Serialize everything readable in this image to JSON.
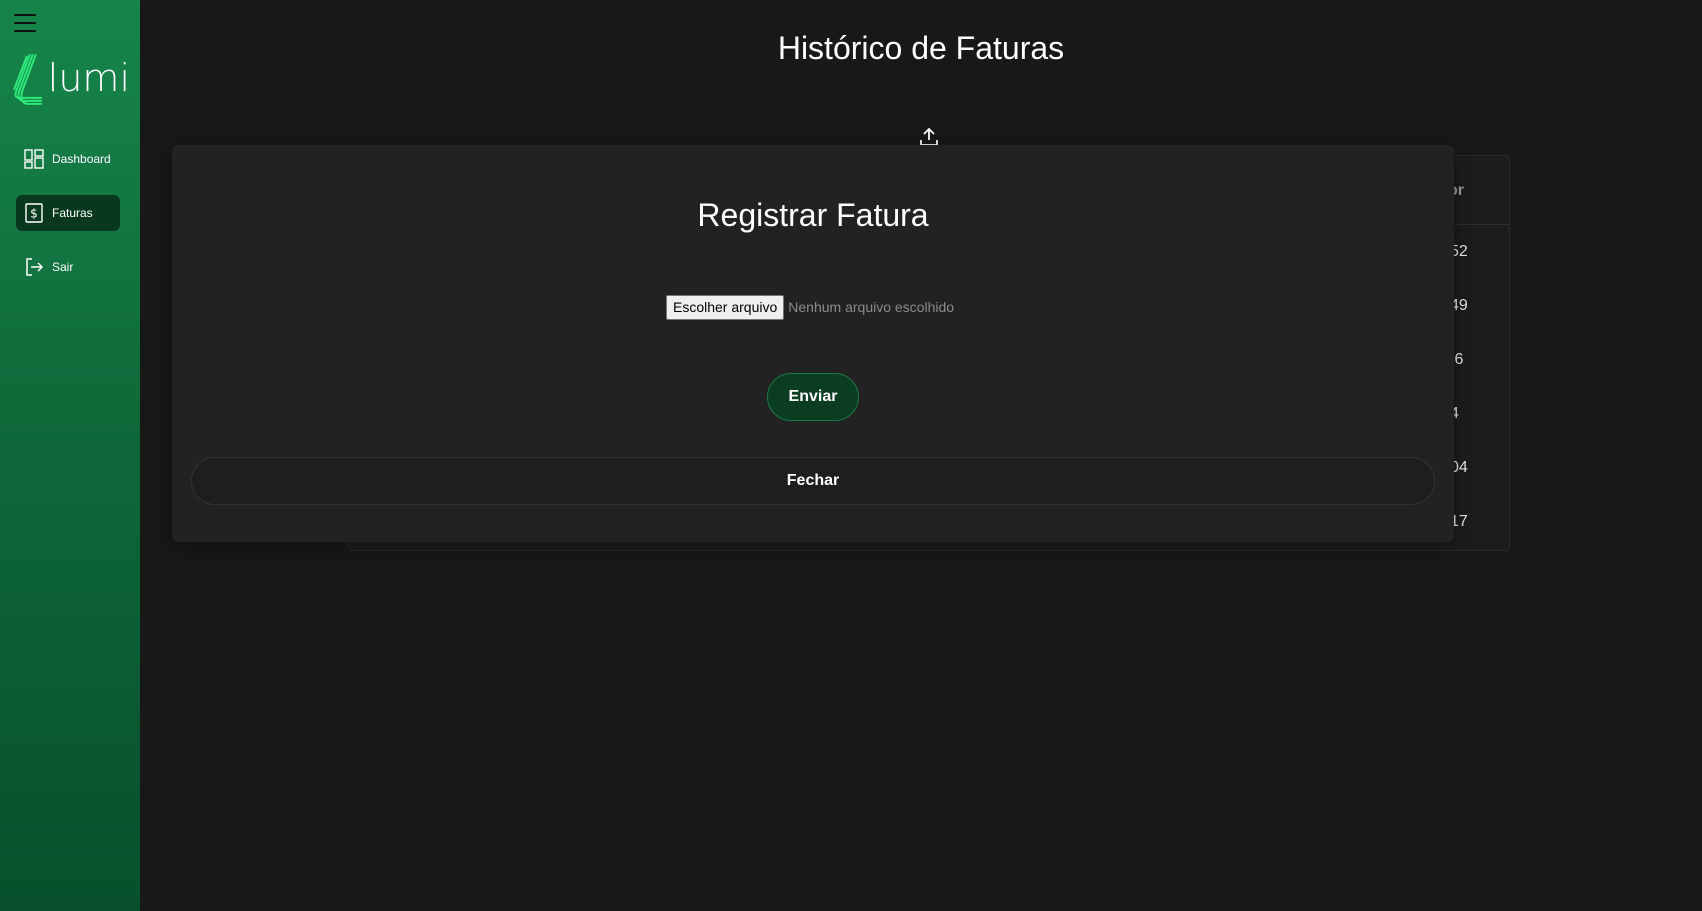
{
  "sidebar": {
    "logo_text": "lumi",
    "items": [
      {
        "label": "Dashboard",
        "icon": "dashboard-grid-icon"
      },
      {
        "label": "Faturas",
        "icon": "dollar-document-icon"
      },
      {
        "label": "Sair",
        "icon": "logout-icon"
      }
    ],
    "active_item": "Faturas"
  },
  "page": {
    "title": "Histórico de Faturas"
  },
  "table": {
    "visible_header_fragment": "or",
    "visible_value_fragments": [
      "52",
      "49",
      ",6",
      "4",
      "04",
      "17"
    ]
  },
  "modal": {
    "title": "Registrar Fatura",
    "file_button_label": "Escolher arquivo",
    "file_status": "Nenhum arquivo escolhido",
    "send_label": "Enviar",
    "close_label": "Fechar"
  },
  "colors": {
    "sidebar_top": "#16854a",
    "sidebar_bottom": "#07502b",
    "active_nav": "#08381e",
    "background": "#181818",
    "modal_bg": "#222222",
    "send_button_bg": "#0a3d22"
  }
}
